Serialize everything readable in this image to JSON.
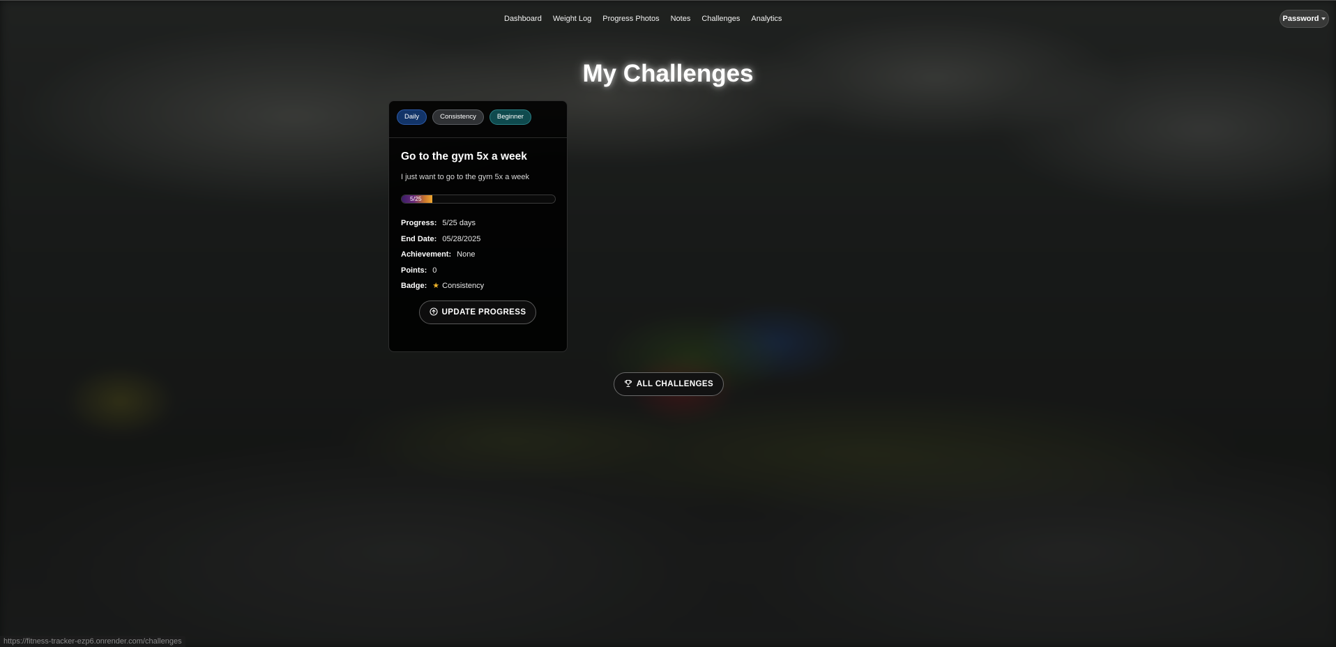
{
  "nav": {
    "links": [
      "Dashboard",
      "Weight Log",
      "Progress Photos",
      "Notes",
      "Challenges",
      "Analytics"
    ],
    "user_menu_label": "Password"
  },
  "page": {
    "title": "My Challenges"
  },
  "challenge": {
    "tags": [
      "Daily",
      "Consistency",
      "Beginner"
    ],
    "title": "Go to the gym 5x a week",
    "description": "I just want to go to the gym 5x a week",
    "progress": {
      "label": "5/25",
      "fraction": 0.2
    },
    "details": {
      "progress_key": "Progress:",
      "progress_value": "5/25 days",
      "end_date_key": "End Date:",
      "end_date_value": "05/28/2025",
      "achievement_key": "Achievement:",
      "achievement_value": "None",
      "points_key": "Points:",
      "points_value": "0",
      "badge_key": "Badge:",
      "badge_value": "Consistency"
    },
    "update_button_label": "UPDATE PROGRESS"
  },
  "all_challenges_button_label": "ALL CHALLENGES",
  "status_bar": {
    "url": "https://fitness-tracker-ezp6.onrender.com/challenges"
  },
  "colors": {
    "tag_daily": "#123468",
    "tag_consistency": "#2f3134",
    "tag_beginner": "#0f4a4e",
    "badge_star": "#f1b52a"
  },
  "icons": {
    "update_button": "arrow-up-circle-icon",
    "all_challenges_button": "trophy-icon",
    "badge": "star-icon",
    "user_menu": "caret-down-icon"
  }
}
